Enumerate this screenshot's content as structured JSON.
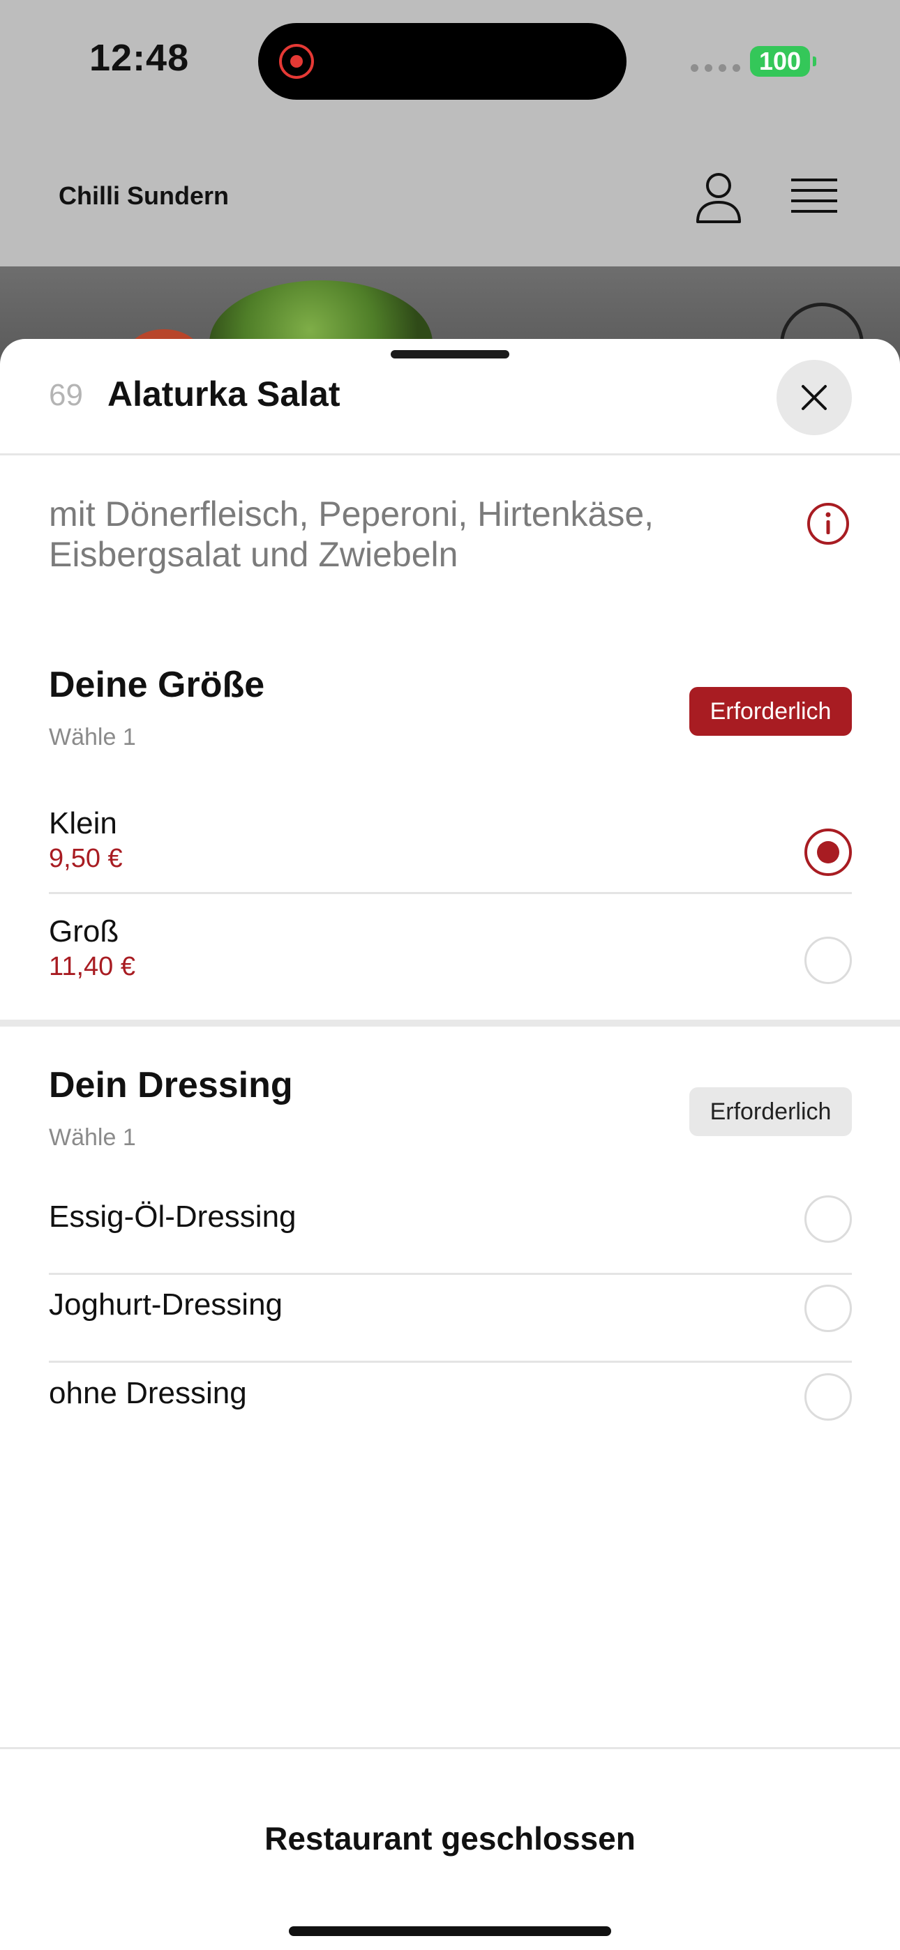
{
  "status_bar": {
    "time": "12:48",
    "battery": "100",
    "battery_color": "#34c759",
    "recording_color": "#e53935"
  },
  "header": {
    "restaurant": "Chilli Sundern",
    "user_icon": "user-icon",
    "menu_icon": "hamburger-menu-icon"
  },
  "sheet": {
    "item_number": "69",
    "title": "Alaturka Salat",
    "description": "mit Dönerfleisch, Peperoni, Hirtenkäse, Eisbergsalat und Zwiebeln"
  },
  "groups": [
    {
      "title": "Deine Größe",
      "subtitle": "Wähle 1",
      "badge": "Erforderlich",
      "options": [
        {
          "label": "Klein",
          "price": "9,50 €",
          "selected": true
        },
        {
          "label": "Groß",
          "price": "11,40 €",
          "selected": false
        }
      ]
    },
    {
      "title": "Dein Dressing",
      "subtitle": "Wähle 1",
      "badge": "Erforderlich",
      "options": [
        {
          "label": "Essig-Öl-Dressing",
          "selected": false
        },
        {
          "label": "Joghurt-Dressing",
          "selected": false
        },
        {
          "label": "ohne Dressing",
          "selected": false
        }
      ]
    }
  ],
  "footer": {
    "status": "Restaurant geschlossen"
  },
  "colors": {
    "accent": "#a81c22",
    "description": "#7b7b7b"
  }
}
